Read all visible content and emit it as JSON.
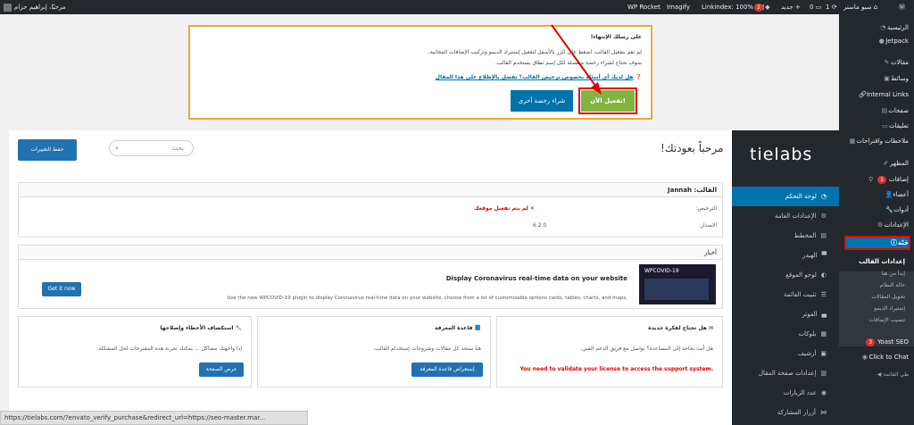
{
  "adminbar": {
    "user_label": "مرحبًا، إبراهيم حزام",
    "wp_rocket": "WP Rocket",
    "imagify": "Imagify",
    "linkindex": "Linkindex: 100%",
    "updates_count": "2",
    "new_label": "جديد",
    "comments_count": "0",
    "one_label": "1",
    "site_name": "سيو ماستر",
    "wp_logo": "wordpress-icon"
  },
  "sidebar": {
    "items": [
      {
        "label": "الرئيسية",
        "icon": "dashboard-icon"
      },
      {
        "label": "Jetpack",
        "icon": "jetpack-icon"
      },
      {
        "label": "مقالات",
        "icon": "pin-icon"
      },
      {
        "label": "وسائط",
        "icon": "media-icon"
      },
      {
        "label": "Internal Links",
        "icon": "link-icon"
      },
      {
        "label": "صفحات",
        "icon": "page-icon"
      },
      {
        "label": "تعليقات",
        "icon": "comment-icon"
      },
      {
        "label": "ملاحظات واقتراحات",
        "icon": "feedback-icon"
      },
      {
        "label": "المظهر",
        "icon": "brush-icon"
      },
      {
        "label": "إضافات",
        "icon": "plugin-icon",
        "badge": "1"
      },
      {
        "label": "أعضاء",
        "icon": "users-icon"
      },
      {
        "label": "أدوات",
        "icon": "tools-icon"
      },
      {
        "label": "الإعدادات",
        "icon": "settings-icon"
      }
    ],
    "active": {
      "label": "جَنّة",
      "icon": "info-icon"
    },
    "sub_current": "إعدادات القالب",
    "sub_items": [
      "إبدأ من هنا",
      "حالة النظام",
      "تحويل المقالات",
      "إستيراد الديمو",
      "تنصيب الإضافات"
    ],
    "after": [
      {
        "label": "Yoast SEO",
        "icon": "yoast-icon",
        "badge": "3"
      },
      {
        "label": "Click to Chat",
        "icon": "chat-icon"
      }
    ],
    "collapse": "طي القائمة"
  },
  "notice": {
    "title": "على رسلك الإنتهاء!",
    "line1": "لم تقم بتفعيل القالب، اضغط على الزر بالأسفل لتفعيل إستيراد الديمو وتركيب الإضافات المجانية،",
    "line2": "سوف تحتاج لشراء رخصة منفصلة لكل إسم نطاق يستخدم القالب.",
    "link": "هل لديك أي أسئلة بخصوص ترخيص القالب؟ تفضل بالإطلاع على هذا المقال",
    "activate_btn": "تفعيل الآن!",
    "buy_btn": "شراء رخصة أخرى"
  },
  "panel": {
    "logo": "tielabs",
    "welcome": "مرحباً بعودتك!",
    "search_placeholder": "بحث",
    "save_btn": "حفظ التغييرات",
    "menu": [
      {
        "label": "لوحة التحكم",
        "icon": "dashboard-icon",
        "active": true
      },
      {
        "label": "الإعدادات العامة",
        "icon": "gear-icon"
      },
      {
        "label": "المخطط",
        "icon": "layout-icon"
      },
      {
        "label": "الهيدر",
        "icon": "header-icon"
      },
      {
        "label": "لوجو الموقع",
        "icon": "logo-icon"
      },
      {
        "label": "تثبيت القائمة",
        "icon": "menu-icon"
      },
      {
        "label": "الفوتر",
        "icon": "footer-icon"
      },
      {
        "label": "بلوكات",
        "icon": "blocks-icon"
      },
      {
        "label": "أرشيف",
        "icon": "archive-icon"
      },
      {
        "label": "إعدادات صفحة المقال",
        "icon": "article-icon"
      },
      {
        "label": "عدد الزيارات",
        "icon": "eye-icon"
      },
      {
        "label": "أزرار المشاركة",
        "icon": "share-icon"
      }
    ],
    "theme_box": {
      "header": "القالب: Jannah",
      "license_label": "الترخيص:",
      "license_value": "✕ لم يتم تفعيل موقعك",
      "version_label": "الاصدار:",
      "version_value": "6.2.0"
    },
    "news": {
      "header": "أخبار",
      "title": "Display Coronavirus real-time data on your website",
      "desc": "Use the new WPCOVID-19 plugin to display Coronavirus real-time data on your website, choose from a lot of customizable options cards, tables, charts, and maps.",
      "button": "Get it now",
      "image_title": "WPCOVID-19"
    },
    "cards": [
      {
        "title": "هل تحتاج لفكرة جديدة",
        "text": "هل أنت بحاجة إلى المساعدة؟ تواصل مع فريق الدعم الفني.",
        "alert": "You need to validate your license to access the support system."
      },
      {
        "title": "قاعدة المعرفة",
        "text": "هنا ستجد كل مقالات وشروحات إستخدام القالب.",
        "button": "إستعراض قاعدة المعرفة"
      },
      {
        "title": "استكشاف الأخطاء وإصلاحها",
        "text": "إذا واجهتك مشاكل ... يمكنك تجربة هذه المقترحات لحل المشكلة.",
        "button": "عرض الصفحة"
      }
    ]
  },
  "statusbar": {
    "url": "https://tielabs.com/?envato_verify_purchase&redirect_url=https://seo-master.mar..."
  },
  "colors": {
    "accent": "#0073aa",
    "alert": "#e60000",
    "highlight": "#e00000",
    "green": "#82b440"
  }
}
